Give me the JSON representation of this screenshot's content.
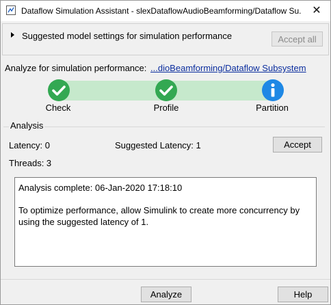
{
  "window": {
    "title": "Dataflow Simulation Assistant - slexDataflowAudioBeamforming/Dataflow Su...",
    "close_glyph": "✕",
    "icon": "simulink-app-icon"
  },
  "suggested_settings": {
    "label": "Suggested model settings for simulation performance",
    "accept_all_label": "Accept all",
    "accept_all_enabled": false
  },
  "analyze_target": {
    "label": "Analyze for simulation performance:",
    "link_text": "...dioBeamforming/Dataflow Subsystem"
  },
  "progress": {
    "steps": [
      {
        "label": "Check",
        "status": "complete",
        "icon": "checkmark-icon"
      },
      {
        "label": "Profile",
        "status": "complete",
        "icon": "checkmark-icon"
      },
      {
        "label": "Partition",
        "status": "info",
        "icon": "info-icon"
      }
    ],
    "colors": {
      "complete": "#33a852",
      "info": "#1e88e5",
      "track": "#c6e9cc"
    }
  },
  "analysis": {
    "group_label": "Analysis",
    "latency": "Latency: 0",
    "suggested_latency": "Suggested Latency: 1",
    "threads": "Threads: 3",
    "accept_label": "Accept",
    "log_line1": "Analysis complete: 06-Jan-2020 17:18:10",
    "log_line2": "To optimize performance, allow Simulink to create more concurrency by using the suggested latency of 1."
  },
  "footer": {
    "analyze_label": "Analyze",
    "help_label": "Help"
  }
}
